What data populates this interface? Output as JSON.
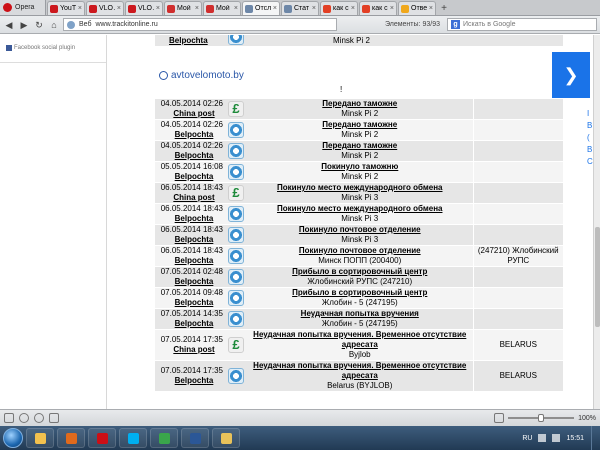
{
  "browser": {
    "menu_label": "Opera",
    "tabs": [
      {
        "label": "YouT…",
        "icon_color": "#cc181e",
        "icon": "youtube-icon"
      },
      {
        "label": "VLO…",
        "icon_color": "#cc181e",
        "icon": "youtube-icon"
      },
      {
        "label": "VLO…",
        "icon_color": "#cc181e",
        "icon": "youtube-icon"
      },
      {
        "label": "Мой …",
        "icon_color": "#d02e2e",
        "icon": "page-icon"
      },
      {
        "label": "Мой …",
        "icon_color": "#d02e2e",
        "icon": "page-icon"
      },
      {
        "label": "Отсл…",
        "icon_color": "#6d87a8",
        "icon": "page-icon"
      },
      {
        "label": "Стат…",
        "icon_color": "#6d87a8",
        "icon": "page-icon"
      },
      {
        "label": "как с…",
        "icon_color": "#e23f25",
        "icon": "yandex-icon"
      },
      {
        "label": "как с…",
        "icon_color": "#e23f25",
        "icon": "yandex-icon"
      },
      {
        "label": "Отве…",
        "icon_color": "#f0a81c",
        "icon": "page-icon"
      }
    ],
    "web_label": "Веб",
    "url": "www.trackitonline.ru",
    "elements_label": "Элементы:",
    "elements_count": "93/93",
    "search_placeholder": "Искать в Google",
    "zoom": "100%"
  },
  "left_panel": {
    "plugin_label": "Facebook social plugin"
  },
  "ad": {
    "link_text": "avtovelomoto.by",
    "exclamation": "!",
    "box_arrow": "❯",
    "close_mark": "▸",
    "side_letters": [
      "I",
      "B",
      "(",
      "B",
      "C"
    ]
  },
  "tracking": {
    "top_row": {
      "service": "Belpochta",
      "location": "Minsk Pi 2"
    },
    "rows": [
      {
        "datetime": "04.05.2014 02:26",
        "service": "China post",
        "icon": "china",
        "status": "Передано таможне",
        "location": "Minsk Pi 2",
        "place": ""
      },
      {
        "datetime": "04.05.2014 02:26",
        "service": "Belpochta",
        "icon": "belpochta",
        "status": "Передано таможне",
        "location": "Minsk Pi 2",
        "place": ""
      },
      {
        "datetime": "04.05.2014 02:26",
        "service": "Belpochta",
        "icon": "belpochta",
        "status": "Передано таможне",
        "location": "Minsk Pi 2",
        "place": ""
      },
      {
        "datetime": "05.05.2014 16:08",
        "service": "Belpochta",
        "icon": "belpochta",
        "status": "Покинуло таможню",
        "location": "Minsk Pi 2",
        "place": ""
      },
      {
        "datetime": "06.05.2014 18:43",
        "service": "China post",
        "icon": "china",
        "status": "Покинуло место международного обмена",
        "location": "Minsk Pi 3",
        "place": ""
      },
      {
        "datetime": "06.05.2014 18:43",
        "service": "Belpochta",
        "icon": "belpochta",
        "status": "Покинуло место международного обмена",
        "location": "Minsk Pi 3",
        "place": ""
      },
      {
        "datetime": "06.05.2014 18:43",
        "service": "Belpochta",
        "icon": "belpochta",
        "status": "Покинуло почтовое отделение",
        "location": "Minsk Pi 3",
        "place": ""
      },
      {
        "datetime": "06.05.2014 18:43",
        "service": "Belpochta",
        "icon": "belpochta",
        "status": "Покинуло почтовое отделение",
        "location": "Минск ПОПП (200400)",
        "place": "(247210) Жлобинский РУПС"
      },
      {
        "datetime": "07.05.2014 02:48",
        "service": "Belpochta",
        "icon": "belpochta",
        "status": "Прибыло в сортировочный центр",
        "location": "Жлобинский РУПС (247210)",
        "place": ""
      },
      {
        "datetime": "07.05.2014 09:48",
        "service": "Belpochta",
        "icon": "belpochta",
        "status": "Прибыло в сортировочный центр",
        "location": "Жлобин - 5 (247195)",
        "place": ""
      },
      {
        "datetime": "07.05.2014 14:35",
        "service": "Belpochta",
        "icon": "belpochta",
        "status": "Неудачная попытка вручения",
        "location": "Жлобин - 5 (247195)",
        "place": ""
      },
      {
        "datetime": "07.05.2014 17:35",
        "service": "China post",
        "icon": "china",
        "status": "Неудачная попытка вручения. Временное отсутствие адресата",
        "location": "Byjlob",
        "place": "BELARUS"
      },
      {
        "datetime": "07.05.2014 17:35",
        "service": "Belpochta",
        "icon": "belpochta",
        "status": "Неудачная попытка вручения. Временное отсутствие адресата",
        "location": "Belarus (BYJLOB)",
        "place": "BELARUS"
      }
    ]
  },
  "taskbar": {
    "apps": [
      {
        "name": "explorer",
        "color": "#f2c14e"
      },
      {
        "name": "media-player",
        "color": "#e06a1c"
      },
      {
        "name": "opera",
        "color": "#cc0f16"
      },
      {
        "name": "skype",
        "color": "#00aff0"
      },
      {
        "name": "utorrent",
        "color": "#3aa64b"
      },
      {
        "name": "word",
        "color": "#2b5797"
      },
      {
        "name": "paint",
        "color": "#e8c25a"
      }
    ],
    "language": "RU",
    "time": "15:51"
  }
}
